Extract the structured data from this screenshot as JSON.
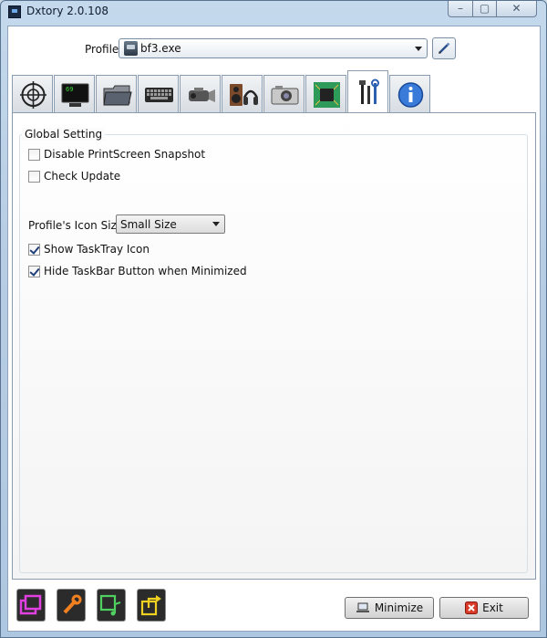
{
  "window": {
    "title": "Dxtory 2.0.108"
  },
  "profile": {
    "label": "Profile",
    "value": "bf3.exe"
  },
  "tabs": [
    {
      "icon": "crosshair-icon"
    },
    {
      "icon": "monitor-icon",
      "text": "69"
    },
    {
      "icon": "folder-icon"
    },
    {
      "icon": "keyboard-icon"
    },
    {
      "icon": "camcorder-icon"
    },
    {
      "icon": "audio-icon"
    },
    {
      "icon": "camera-icon"
    },
    {
      "icon": "chip-icon"
    },
    {
      "icon": "tools-icon",
      "active": true
    },
    {
      "icon": "info-icon"
    }
  ],
  "global": {
    "title": "Global Setting",
    "disable_printscreen": {
      "label": "Disable PrintScreen Snapshot",
      "checked": false
    },
    "check_update": {
      "label": "Check Update",
      "checked": false
    },
    "icon_size": {
      "label": "Profile's Icon Size",
      "value": "Small Size"
    },
    "show_tasktray": {
      "label": "Show TaskTray Icon",
      "checked": true
    },
    "hide_taskbar": {
      "label": "Hide TaskBar Button when Minimized",
      "checked": true
    }
  },
  "footer": {
    "minimize_label": "Minimize",
    "exit_label": "Exit"
  },
  "colors": {
    "pink": "#e040e0",
    "orange": "#f08020",
    "green": "#50d060",
    "yellow": "#f0d020"
  }
}
